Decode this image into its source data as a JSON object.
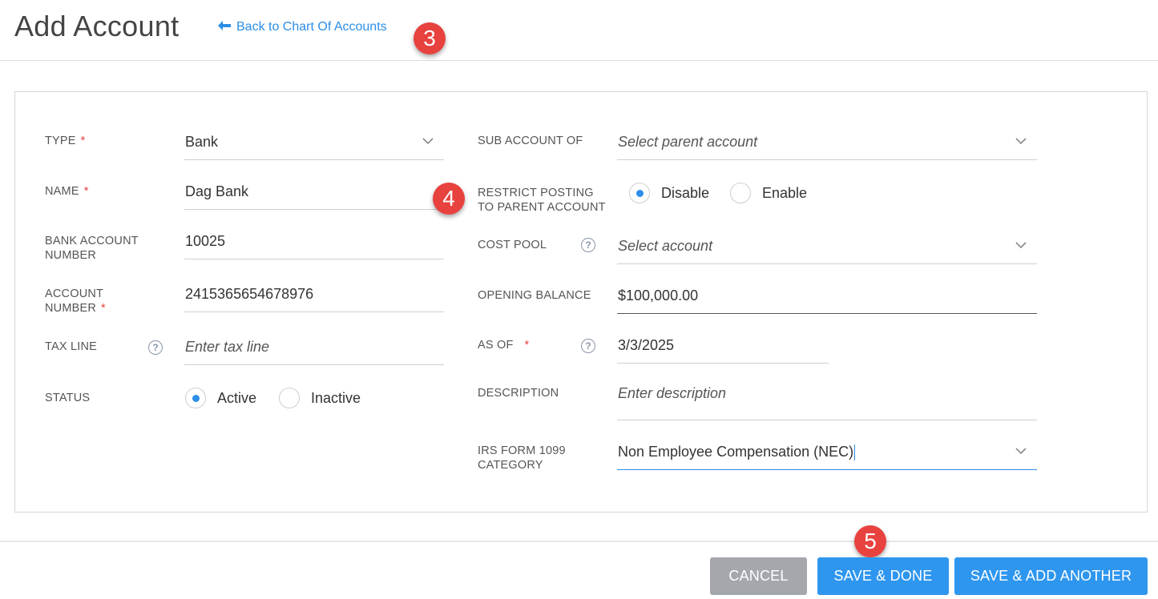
{
  "header": {
    "title": "Add Account",
    "back_link": "Back to Chart Of Accounts"
  },
  "badges": [
    "3",
    "4",
    "5"
  ],
  "form": {
    "left": {
      "type": {
        "label": "TYPE",
        "value": "Bank"
      },
      "name": {
        "label": "NAME",
        "value": "Dag Bank"
      },
      "bank_account_number": {
        "label_line1": "BANK ACCOUNT",
        "label_line2": "NUMBER",
        "value": "10025"
      },
      "account_number": {
        "label_line1": "ACCOUNT",
        "label_line2": "NUMBER",
        "value": "2415365654678976"
      },
      "tax_line": {
        "label": "TAX LINE",
        "placeholder": "Enter tax line"
      },
      "status": {
        "label": "STATUS",
        "options": [
          "Active",
          "Inactive"
        ],
        "selected": "Active"
      }
    },
    "right": {
      "sub_account_of": {
        "label": "SUB ACCOUNT OF",
        "placeholder": "Select parent account"
      },
      "restrict_posting": {
        "label_line1": "RESTRICT POSTING",
        "label_line2": "TO PARENT ACCOUNT",
        "options": [
          "Disable",
          "Enable"
        ],
        "selected": "Disable"
      },
      "cost_pool": {
        "label": "COST POOL",
        "placeholder": "Select account"
      },
      "opening_balance": {
        "label": "OPENING BALANCE",
        "value": "$100,000.00"
      },
      "as_of": {
        "label": "AS OF",
        "value": "3/3/2025"
      },
      "description": {
        "label": "DESCRIPTION",
        "placeholder": "Enter description"
      },
      "irs_1099": {
        "label_line1": "IRS FORM 1099",
        "label_line2": "CATEGORY",
        "value": "Non Employee Compensation (NEC)"
      }
    },
    "required_mark": "*",
    "help_glyph": "?"
  },
  "footer": {
    "cancel": "CANCEL",
    "save_done": "SAVE & DONE",
    "save_add": "SAVE & ADD ANOTHER"
  },
  "colors": {
    "accent": "#2b8ee6",
    "badge": "#e8423f",
    "required": "#e8423f",
    "cancel_bg": "#a4a7ab",
    "primary_bg": "#2e96ee"
  }
}
